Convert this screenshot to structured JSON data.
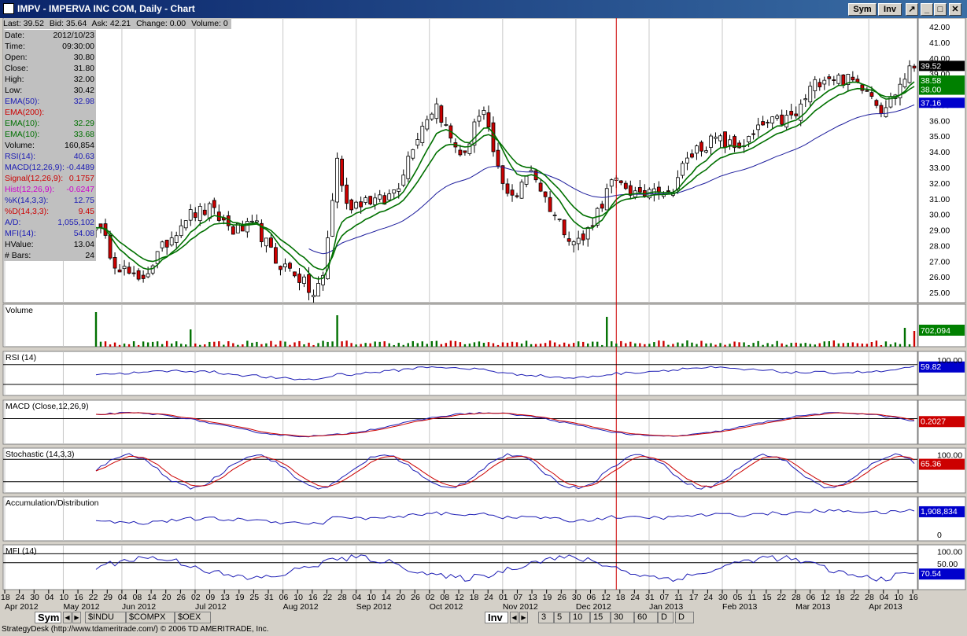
{
  "window": {
    "title": "IMPV - IMPERVA INC COM, Daily - Chart",
    "buttons": [
      "Sym",
      "Inv"
    ]
  },
  "quote": {
    "last": "Last: 39.52",
    "bid": "Bid: 35.64",
    "ask": "Ask: 42.21",
    "change": "Change: 0.00",
    "volume": "Volume: 0"
  },
  "info": [
    {
      "k": "Date:",
      "v": "2012/10/23",
      "color": "#000000"
    },
    {
      "k": "Time:",
      "v": "09:30:00",
      "color": "#000000"
    },
    {
      "k": "Open:",
      "v": "30.80",
      "color": "#000000"
    },
    {
      "k": "Close:",
      "v": "31.80",
      "color": "#000000"
    },
    {
      "k": "High:",
      "v": "32.00",
      "color": "#000000"
    },
    {
      "k": "Low:",
      "v": "30.42",
      "color": "#000000"
    },
    {
      "k": "EMA(50):",
      "v": "32.98",
      "color": "#1c1cb4"
    },
    {
      "k": "EMA(200):",
      "v": "",
      "color": "#cc0000"
    },
    {
      "k": "EMA(10):",
      "v": "32.29",
      "color": "#007000"
    },
    {
      "k": "EMA(10):",
      "v": "33.68",
      "color": "#007000"
    },
    {
      "k": "Volume:",
      "v": "160,854",
      "color": "#000000"
    },
    {
      "k": "RSI(14):",
      "v": "40.63",
      "color": "#1c1cb4"
    },
    {
      "k": "MACD(12,26,9):",
      "v": "-0.4489",
      "color": "#1c1cb4"
    },
    {
      "k": "Signal(12,26,9):",
      "v": "0.1757",
      "color": "#cc0000"
    },
    {
      "k": "Hist(12,26,9):",
      "v": "-0.6247",
      "color": "#cc00cc"
    },
    {
      "k": "%K(14,3,3):",
      "v": "12.75",
      "color": "#1c1cb4"
    },
    {
      "k": "%D(14,3,3):",
      "v": "9.45",
      "color": "#cc0000"
    },
    {
      "k": "A/D:",
      "v": "1,055,102",
      "color": "#1c1cb4"
    },
    {
      "k": "MFI(14):",
      "v": "54.08",
      "color": "#1c1cb4"
    },
    {
      "k": "HValue:",
      "v": "13.04",
      "color": "#000000"
    },
    {
      "k": "# Bars:",
      "v": "24",
      "color": "#000000"
    }
  ],
  "chart_data": {
    "type": "candlestick",
    "price_axis": {
      "min": 24.0,
      "max": 42.0,
      "ticks": [
        "42.00",
        "41.00",
        "40.00",
        "39.00",
        "38.00",
        "37.00",
        "36.00",
        "35.00",
        "34.00",
        "33.00",
        "32.00",
        "31.00",
        "30.00",
        "29.00",
        "28.00",
        "27.00",
        "26.00",
        "25.00"
      ]
    },
    "price_tags": [
      {
        "label": "39.52",
        "value": 39.52,
        "bg": "#000000",
        "fg": "#ffffff"
      },
      {
        "label": "38.58",
        "value": 38.58,
        "bg": "#008000",
        "fg": "#ffffff"
      },
      {
        "label": "38.00",
        "value": 38.0,
        "bg": "#008000",
        "fg": "#ffffff"
      },
      {
        "label": "37.16",
        "value": 37.16,
        "bg": "#0000cc",
        "fg": "#ffffff"
      }
    ],
    "anchors": [
      {
        "d": 0,
        "v": 29.5
      },
      {
        "d": 4,
        "v": 27.0
      },
      {
        "d": 9,
        "v": 25.6
      },
      {
        "d": 14,
        "v": 27.8
      },
      {
        "d": 19,
        "v": 29.9
      },
      {
        "d": 24,
        "v": 30.3
      },
      {
        "d": 29,
        "v": 29.0
      },
      {
        "d": 34,
        "v": 29.2
      },
      {
        "d": 38,
        "v": 27.0
      },
      {
        "d": 42,
        "v": 26.3
      },
      {
        "d": 46,
        "v": 24.8
      },
      {
        "d": 48,
        "v": 26.0
      },
      {
        "d": 51,
        "v": 33.5
      },
      {
        "d": 53,
        "v": 30.5
      },
      {
        "d": 57,
        "v": 31.0
      },
      {
        "d": 61,
        "v": 30.8
      },
      {
        "d": 64,
        "v": 32.0
      },
      {
        "d": 67,
        "v": 34.5
      },
      {
        "d": 70,
        "v": 36.3
      },
      {
        "d": 72,
        "v": 37.0
      },
      {
        "d": 75,
        "v": 34.8
      },
      {
        "d": 78,
        "v": 33.6
      },
      {
        "d": 80,
        "v": 36.0
      },
      {
        "d": 82,
        "v": 36.3
      },
      {
        "d": 84,
        "v": 34.0
      },
      {
        "d": 86,
        "v": 31.8
      },
      {
        "d": 89,
        "v": 31.2
      },
      {
        "d": 92,
        "v": 33.0
      },
      {
        "d": 95,
        "v": 31.0
      },
      {
        "d": 98,
        "v": 29.5
      },
      {
        "d": 101,
        "v": 28.3
      },
      {
        "d": 103,
        "v": 28.4
      },
      {
        "d": 106,
        "v": 30.2
      },
      {
        "d": 109,
        "v": 32.0
      },
      {
        "d": 112,
        "v": 31.8
      },
      {
        "d": 115,
        "v": 31.0
      },
      {
        "d": 118,
        "v": 32.0
      },
      {
        "d": 121,
        "v": 31.2
      },
      {
        "d": 124,
        "v": 33.0
      },
      {
        "d": 127,
        "v": 34.2
      },
      {
        "d": 131,
        "v": 34.8
      },
      {
        "d": 135,
        "v": 34.3
      },
      {
        "d": 138,
        "v": 34.7
      },
      {
        "d": 141,
        "v": 35.7
      },
      {
        "d": 145,
        "v": 36.0
      },
      {
        "d": 148,
        "v": 36.3
      },
      {
        "d": 151,
        "v": 38.0
      },
      {
        "d": 154,
        "v": 38.9
      },
      {
        "d": 157,
        "v": 38.7
      },
      {
        "d": 160,
        "v": 38.5
      },
      {
        "d": 163,
        "v": 38.2
      },
      {
        "d": 166,
        "v": 36.8
      },
      {
        "d": 168,
        "v": 37.3
      },
      {
        "d": 171,
        "v": 38.8
      },
      {
        "d": 173,
        "v": 39.5
      }
    ],
    "ema_slow_start": 27.5,
    "indicator_values": {
      "volume": "702,094",
      "rsi": "59.82",
      "macd": "0.2027",
      "stochastic": "65.36",
      "ad": "1,908,834",
      "ad_zero": "0",
      "mfi": "70.54"
    },
    "panels": [
      {
        "name": "Volume",
        "ticks": []
      },
      {
        "name": "RSI (14)",
        "ticks": [
          "100.00"
        ]
      },
      {
        "name": "MACD (Close,12,26,9)",
        "ticks": []
      },
      {
        "name": "Stochastic (14,3,3)",
        "ticks": [
          "100.00"
        ]
      },
      {
        "name": "Accumulation/Distribution",
        "ticks": []
      },
      {
        "name": "MFI (14)",
        "ticks": [
          "100.00",
          "50.00"
        ]
      }
    ],
    "x_day_labels": [
      "18",
      "24",
      "30",
      "04",
      "10",
      "16",
      "22",
      "29",
      "04",
      "08",
      "14",
      "20",
      "26",
      "02",
      "09",
      "13",
      "19",
      "25",
      "31",
      "06",
      "10",
      "16",
      "22",
      "28",
      "04",
      "10",
      "14",
      "20",
      "26",
      "02",
      "08",
      "12",
      "18",
      "24",
      "01",
      "07",
      "13",
      "19",
      "26",
      "30",
      "06",
      "12",
      "18",
      "24",
      "31",
      "07",
      "11",
      "17",
      "24",
      "30",
      "05",
      "11",
      "15",
      "22",
      "28",
      "06",
      "12",
      "18",
      "22",
      "28",
      "04",
      "10",
      "16"
    ],
    "x_month_labels": [
      {
        "label": "Apr 2012",
        "at": 0
      },
      {
        "label": "May 2012",
        "at": 4
      },
      {
        "label": "Jun 2012",
        "at": 8
      },
      {
        "label": "Jul 2012",
        "at": 13
      },
      {
        "label": "Aug 2012",
        "at": 19
      },
      {
        "label": "Sep 2012",
        "at": 24
      },
      {
        "label": "Oct 2012",
        "at": 29
      },
      {
        "label": "Nov 2012",
        "at": 34
      },
      {
        "label": "Dec 2012",
        "at": 39
      },
      {
        "label": "Jan 2013",
        "at": 44
      },
      {
        "label": "Feb 2013",
        "at": 49
      },
      {
        "label": "Mar 2013",
        "at": 54
      },
      {
        "label": "Apr 2013",
        "at": 59
      }
    ],
    "crosshair_day": 110,
    "total_days": 174
  },
  "tabs": {
    "sym": "Sym",
    "symbols": [
      "$INDU",
      "$COMPX",
      "$OEX"
    ],
    "inv": "Inv",
    "periods": [
      "3",
      "5",
      "10",
      "15",
      "30",
      "60",
      "D",
      "D"
    ]
  },
  "status": "StrategyDesk (http://www.tdameritrade.com/) © 2006 TD AMERITRADE, Inc."
}
